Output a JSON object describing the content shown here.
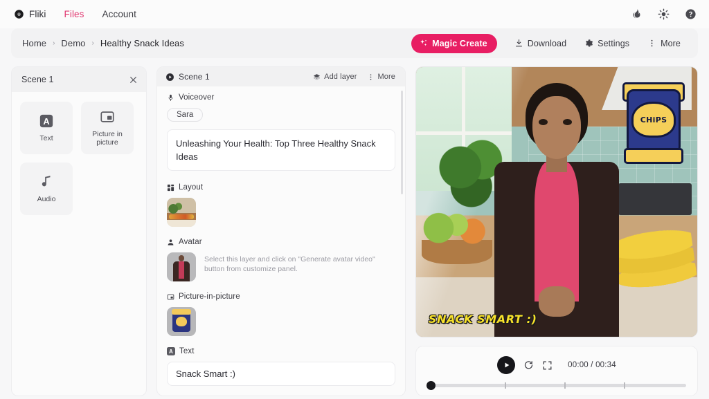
{
  "topnav": {
    "brand": "Fliki",
    "brand_icon": "fliki-logo-icon",
    "links": [
      {
        "label": "Files",
        "active": true
      },
      {
        "label": "Account",
        "active": false
      }
    ],
    "icons": [
      {
        "name": "flame-icon"
      },
      {
        "name": "brightness-sun-icon"
      },
      {
        "name": "help-circle-icon"
      }
    ]
  },
  "toolbar": {
    "breadcrumb": [
      "Home",
      "Demo",
      "Healthy Snack Ideas"
    ],
    "separator": "›",
    "magic_create_label": "Magic Create",
    "magic_create_color": "#e81e63",
    "actions": [
      {
        "label": "Download",
        "icon": "download-icon"
      },
      {
        "label": "Settings",
        "icon": "gear-icon"
      },
      {
        "label": "More",
        "icon": "dots-vertical-icon"
      }
    ]
  },
  "left_panel": {
    "title": "Scene 1",
    "close_icon": "close-icon",
    "cards": [
      {
        "label": "Text",
        "icon": "text-a-icon"
      },
      {
        "label": "Picture in picture",
        "icon": "picture-in-picture-icon"
      },
      {
        "label": "Audio",
        "icon": "music-note-icon"
      }
    ]
  },
  "mid_panel": {
    "scene_title": "Scene 1",
    "play_icon": "play-circle-icon",
    "add_layer_label": "Add layer",
    "add_layer_icon": "layers-icon",
    "more_label": "More",
    "more_icon": "dots-vertical-icon",
    "voiceover": {
      "label": "Voiceover",
      "icon": "microphone-icon",
      "voice_chip": "Sara",
      "script": "Unleashing Your Health: Top Three Healthy Snack Ideas"
    },
    "layout": {
      "label": "Layout",
      "icon": "layout-grid-icon",
      "thumbnail_name": "layout-thumbnail-kitchen"
    },
    "avatar": {
      "label": "Avatar",
      "icon": "person-icon",
      "thumbnail_name": "avatar-thumbnail",
      "hint": "Select this layer and click on \"Generate avatar video\" button from customize panel."
    },
    "pip": {
      "label": "Picture-in-picture",
      "icon": "picture-in-picture-icon",
      "thumbnail_name": "pip-thumbnail-chips-bag"
    },
    "text": {
      "label": "Text",
      "icon": "text-a-icon",
      "value": "Snack Smart :)"
    }
  },
  "preview": {
    "caption": "SNACK SMART :)",
    "caption_color": "#f7e12a",
    "chips_label": "CHiPS",
    "scene_description": "avatar presenter in kitchen with vegetables and bananas"
  },
  "player": {
    "play_icon": "play-icon",
    "replay_icon": "replay-icon",
    "fullscreen_icon": "fullscreen-icon",
    "time": "00:00 / 00:34",
    "current_time": "00:00",
    "duration": "00:34",
    "progress_percent": 0,
    "tick_positions": [
      30,
      53,
      76
    ]
  }
}
